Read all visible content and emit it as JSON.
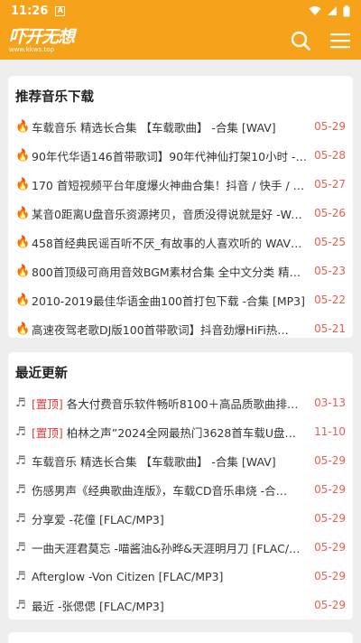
{
  "status": {
    "time": "11:26",
    "app_badge": "A"
  },
  "header": {
    "logo_main": "吓开无想",
    "logo_sub": "www.kkws.top",
    "search_icon": "search-icon",
    "menu_icon": "menu-icon"
  },
  "colors": {
    "brand": "#f7a21b",
    "date": "#e8604c",
    "pinned": "#e8343a"
  },
  "recommended": {
    "title": "推荐音乐下载",
    "items": [
      {
        "text": "车载音乐 精选长合集 【车载歌曲】 -合集 [WAV]",
        "date": "05-29"
      },
      {
        "text": "90年代华语146首带歌词】90年代神仙打架10小时 -…",
        "date": "05-28"
      },
      {
        "text": "170 首短视频平台年度爆火神曲合集！抖音 / 快手 / …",
        "date": "05-27"
      },
      {
        "text": "某音0距离U盘音乐资源拷贝，音质没得说就是好 -WAV…",
        "date": "05-26"
      },
      {
        "text": "458首经典民谣百听不厌_有故事的人喜欢听的 WAV…",
        "date": "05-25"
      },
      {
        "text": "800首顶级可商用音效BGM素材合集 全中文分类 精…",
        "date": "05-23"
      },
      {
        "text": "2010-2019最佳华语金曲100首打包下载 -合集 [MP3]",
        "date": "05-22"
      },
      {
        "text": "高速夜驾老歌DJ版100首带歌词】抖音劲爆HiFi热…",
        "date": "05-21"
      }
    ]
  },
  "recent": {
    "title": "最近更新",
    "items": [
      {
        "tag": "[置顶]",
        "text": " 各大付费音乐软件畅听8100＋高品质歌曲排…",
        "date": "03-13"
      },
      {
        "tag": "[置顶]",
        "text": " 柏林之声”2024全网最热门3628首车载U盘…",
        "date": "11-10"
      },
      {
        "tag": "",
        "text": "车载音乐 精选长合集 【车载歌曲】 -合集 [WAV]",
        "date": "05-29"
      },
      {
        "tag": "",
        "text": "伤感男声《经典歌曲连版》，车载CD音乐串烧 -合…",
        "date": "05-29"
      },
      {
        "tag": "",
        "text": "分享爱 -花僮 [FLAC/MP3]",
        "date": "05-29"
      },
      {
        "tag": "",
        "text": "一曲天涯君莫忘 -喵酱油&孙晔&天涯明月刀 [FLAC/…",
        "date": "05-29"
      },
      {
        "tag": "",
        "text": "Afterglow -Von Citizen [FLAC/MP3]",
        "date": "05-29"
      },
      {
        "tag": "",
        "text": "最近 -张偲偲 [FLAC/MP3]",
        "date": "05-29"
      }
    ]
  }
}
